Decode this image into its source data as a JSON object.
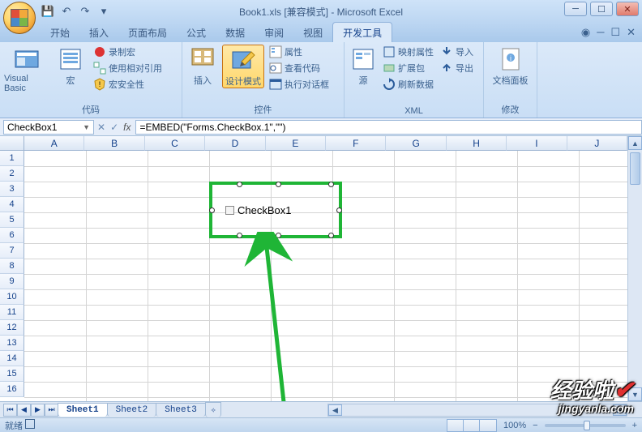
{
  "title": "Book1.xls  [兼容模式] - Microsoft Excel",
  "tabs": [
    "开始",
    "插入",
    "页面布局",
    "公式",
    "数据",
    "审阅",
    "视图",
    "开发工具"
  ],
  "active_tab": 7,
  "ribbon": {
    "g1": {
      "vb": "Visual Basic",
      "macro": "宏",
      "rec": "录制宏",
      "useRel": "使用相对引用",
      "sec": "宏安全性",
      "label": "代码"
    },
    "g2": {
      "insert": "插入",
      "design": "设计模式",
      "prop": "属性",
      "viewcode": "查看代码",
      "dialog": "执行对话框",
      "label": "控件"
    },
    "g3": {
      "source": "源",
      "mapprop": "映射属性",
      "expand": "扩展包",
      "refresh": "刷新数据",
      "import": "导入",
      "export": "导出",
      "label": "XML"
    },
    "g4": {
      "docpanel": "文档面板",
      "label": "修改"
    }
  },
  "name_box": "CheckBox1",
  "fx_label": "fx",
  "formula": "=EMBED(\"Forms.CheckBox.1\",\"\")",
  "columns": [
    "A",
    "B",
    "C",
    "D",
    "E",
    "F",
    "G",
    "H",
    "I",
    "J"
  ],
  "rows": [
    "1",
    "2",
    "3",
    "4",
    "5",
    "6",
    "7",
    "8",
    "9",
    "10",
    "11",
    "12",
    "13",
    "14",
    "15",
    "16"
  ],
  "checkbox_label": "CheckBox1",
  "sheets": [
    "Sheet1",
    "Sheet2",
    "Sheet3"
  ],
  "status": {
    "ready": "就绪",
    "zoom": "100%",
    "minus": "−",
    "plus": "+"
  },
  "watermark": {
    "brand": "经验啦",
    "url": "jingyanla.com"
  }
}
